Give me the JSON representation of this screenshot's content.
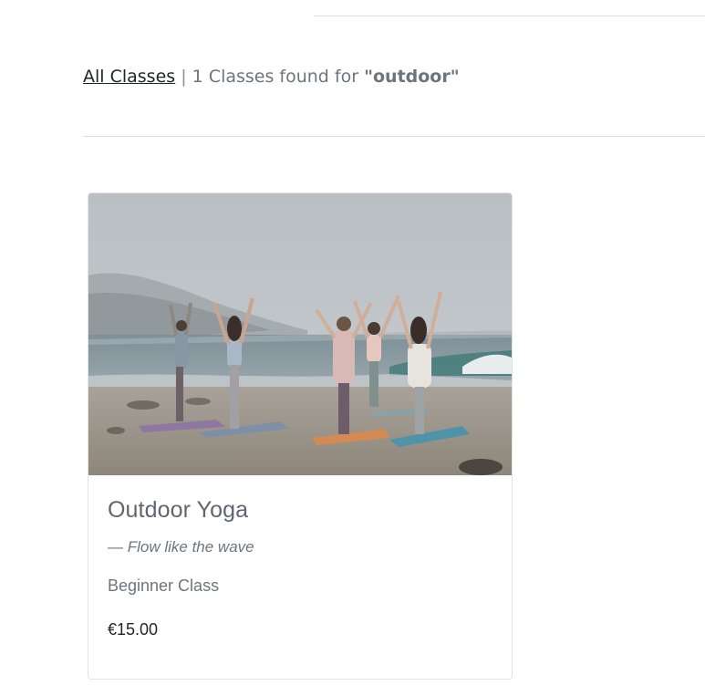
{
  "breadcrumb": {
    "link_label": "All Classes",
    "separator": "|",
    "summary_prefix": "1 Classes found for",
    "query": "\"outdoor\""
  },
  "results": [
    {
      "title": "Outdoor Yoga",
      "tagline": "— Flow like the wave",
      "level": "Beginner Class",
      "price": "€15.00"
    }
  ]
}
